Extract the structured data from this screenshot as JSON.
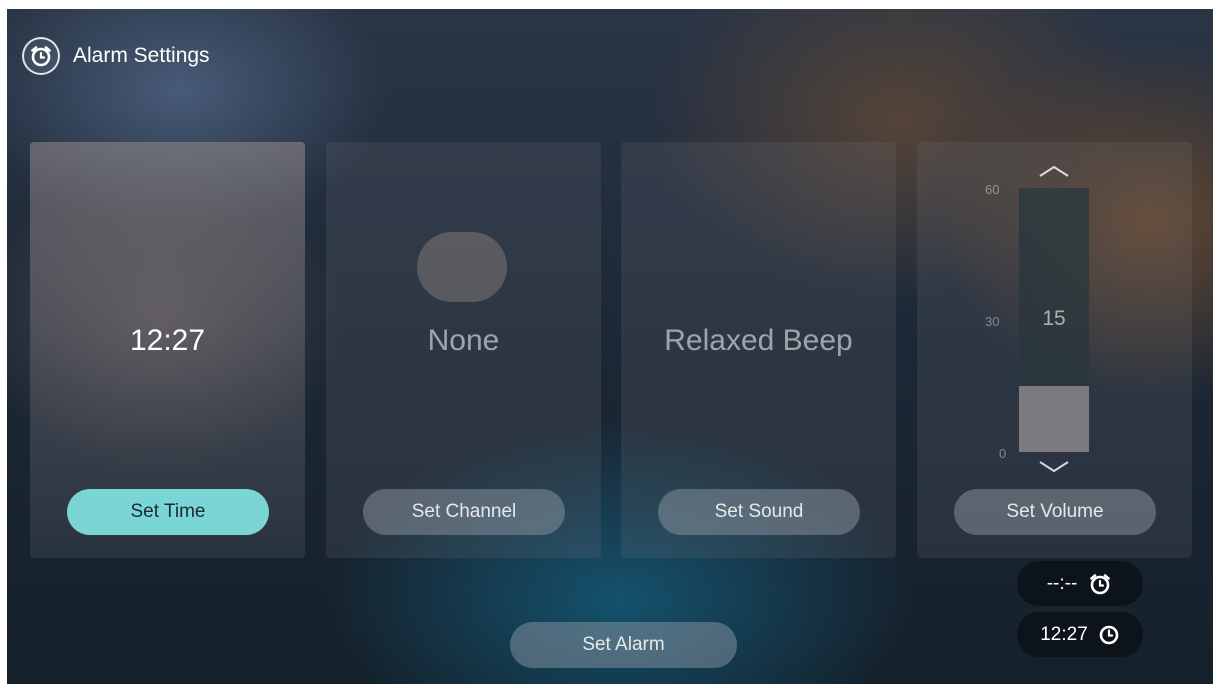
{
  "header": {
    "title": "Alarm Settings",
    "icon": "alarm-clock-icon"
  },
  "cards": {
    "time": {
      "value": "12:27",
      "button": "Set Time"
    },
    "channel": {
      "value": "None",
      "button": "Set Channel"
    },
    "sound": {
      "value": "Relaxed Beep",
      "button": "Set Sound"
    },
    "volume": {
      "value": "15",
      "button": "Set Volume",
      "min": 0,
      "max": 60,
      "ticks": [
        "60",
        "30",
        "0"
      ]
    }
  },
  "set_alarm": "Set Alarm",
  "status": {
    "alarm_time": "--:--",
    "alarm_icon": "alarm-clock-icon",
    "current_time": "12:27",
    "clock_icon": "clock-icon"
  },
  "colors": {
    "accent": "#7ad6d6"
  }
}
